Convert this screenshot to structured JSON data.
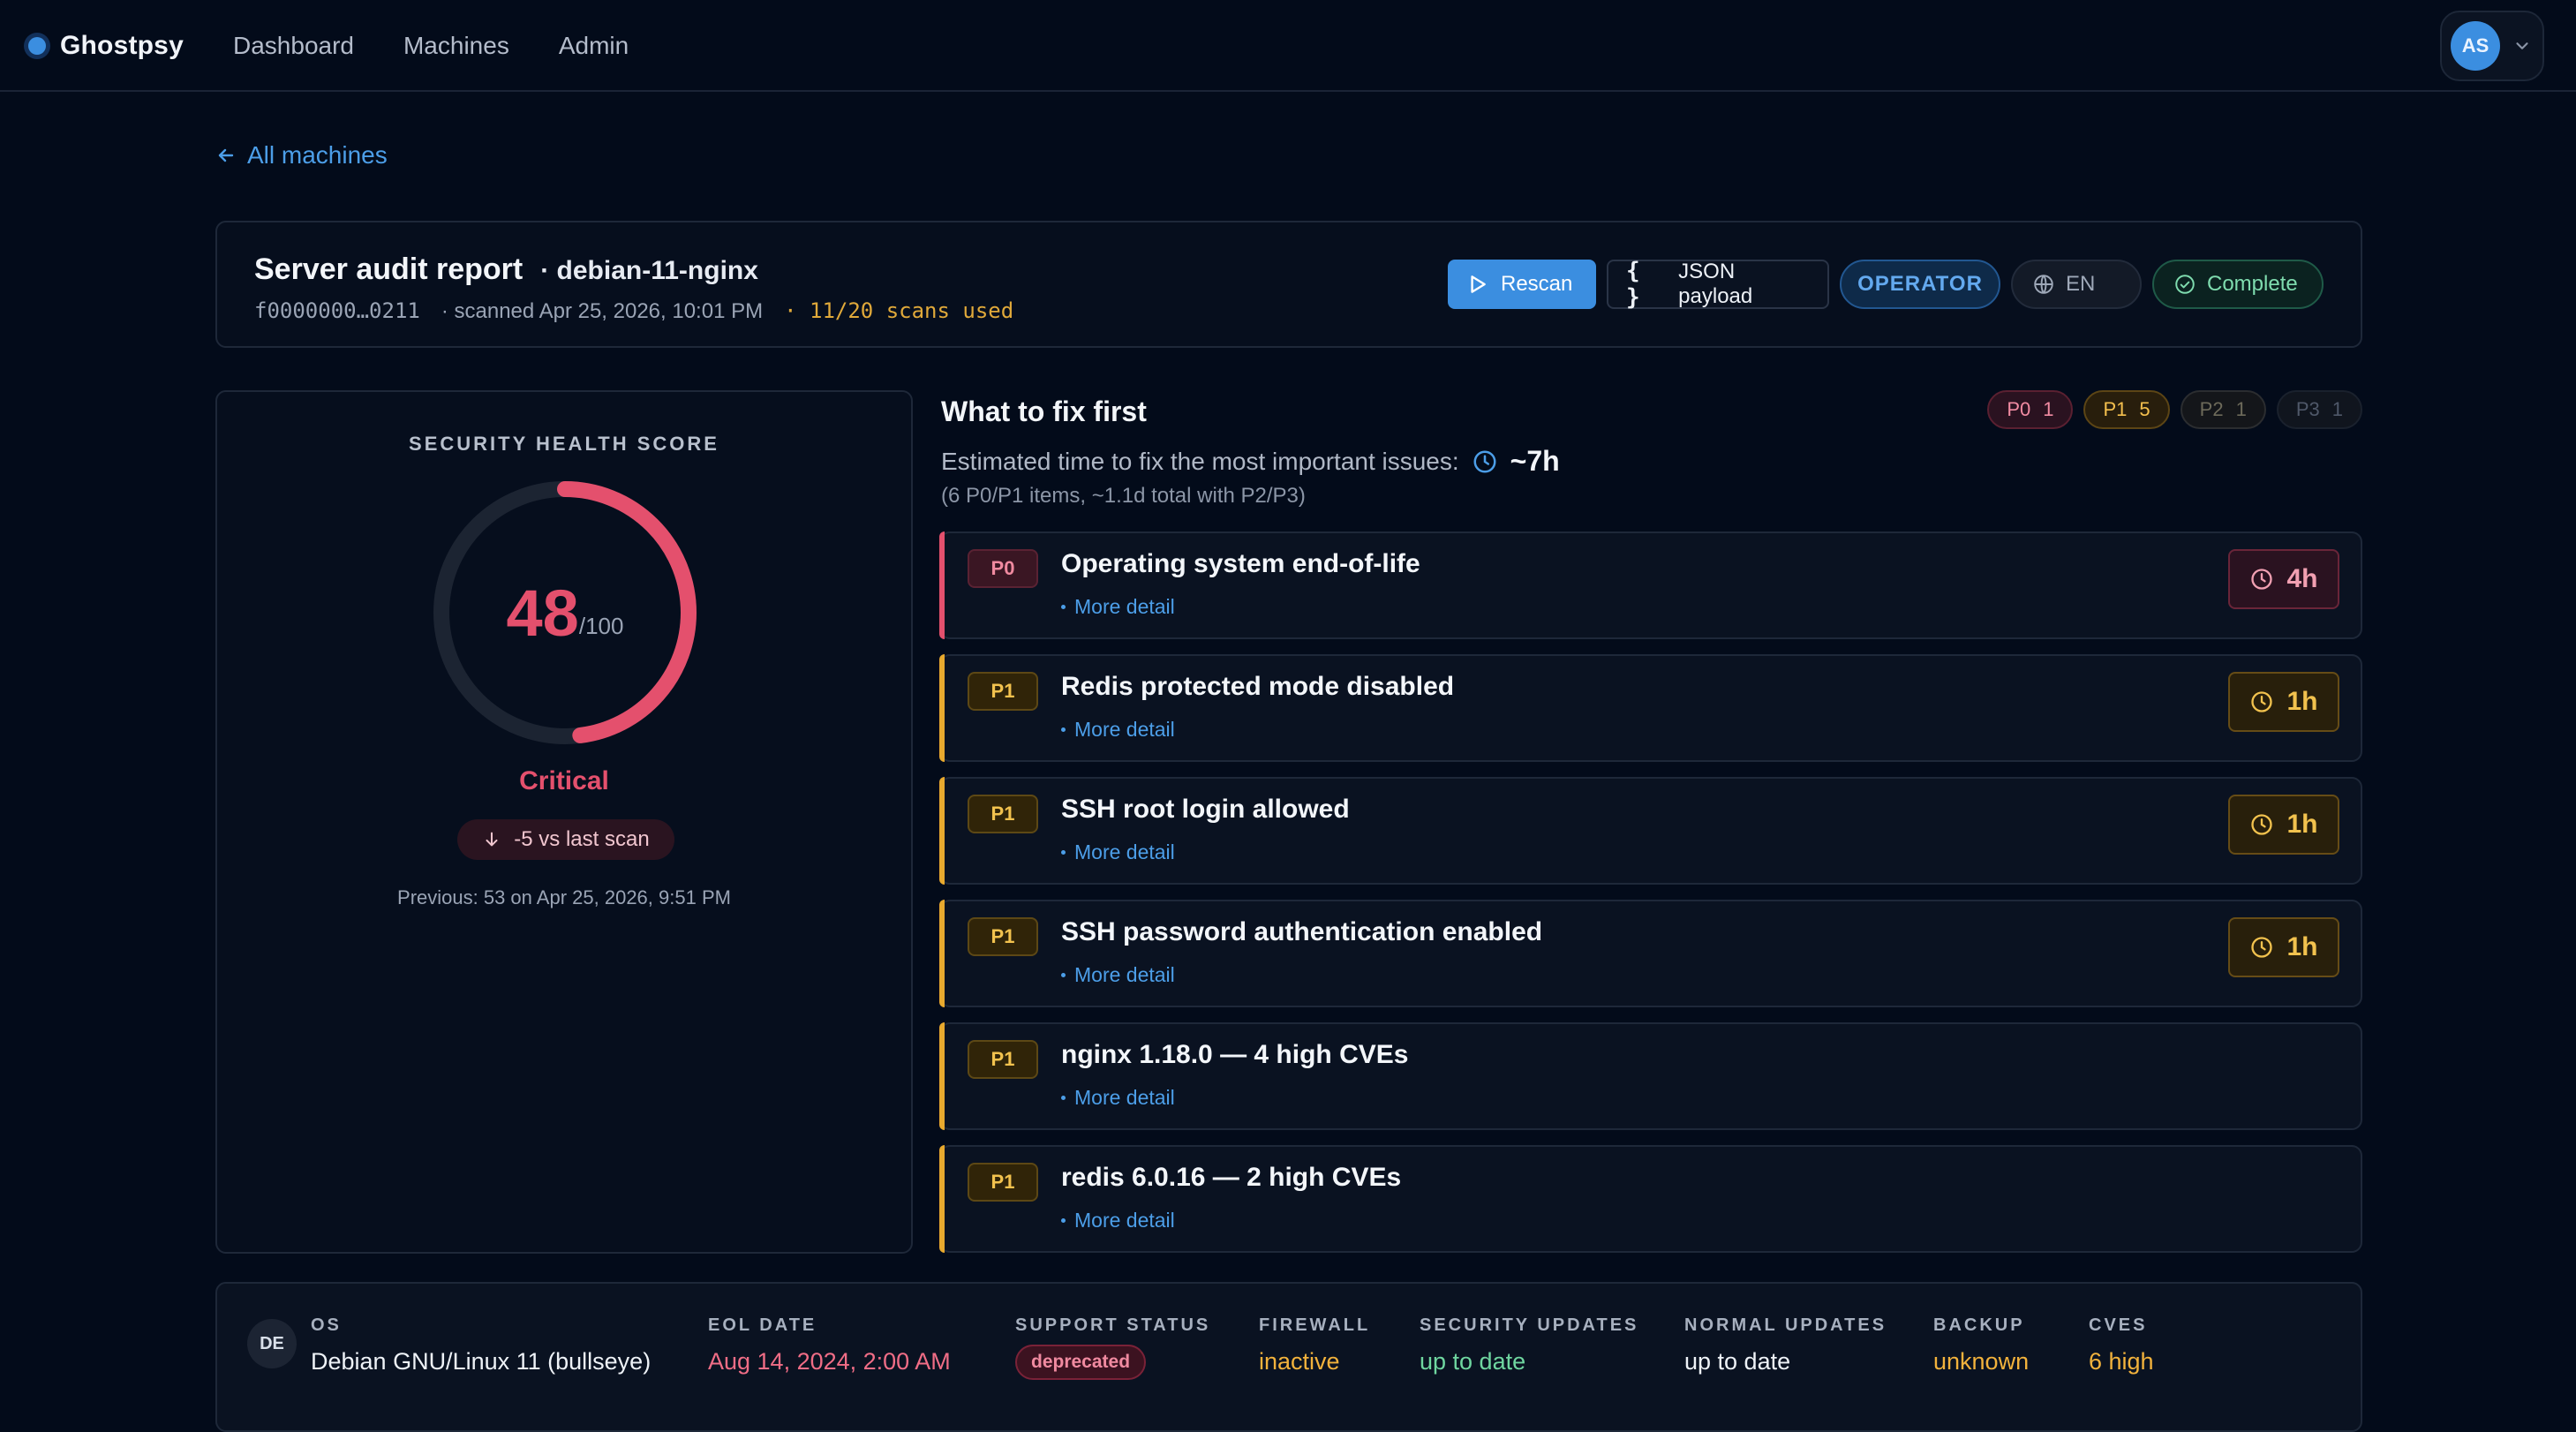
{
  "nav": {
    "brand": "Ghostpsy",
    "links": [
      "Dashboard",
      "Machines",
      "Admin"
    ],
    "user_initials": "AS"
  },
  "back_link": "All machines",
  "header": {
    "title": "Server audit report",
    "machine": "· debian-11-nginx",
    "machine_id": "f0000000…0211",
    "scanned": "· scanned Apr 25, 2026, 10:01 PM",
    "scans_used": "· 11/20 scans used",
    "actions": {
      "rescan": "Rescan",
      "json_payload": "JSON payload",
      "role": "OPERATOR",
      "language": "EN",
      "status": "Complete"
    }
  },
  "score": {
    "label": "SECURITY HEALTH SCORE",
    "value": "48",
    "max": "/100",
    "fraction": 0.48,
    "status": "Critical",
    "delta": "-5 vs last scan",
    "previous": "Previous: 53 on Apr 25, 2026, 9:51 PM",
    "color": "#e4506d"
  },
  "fix_first": {
    "title": "What to fix first",
    "counts": [
      {
        "label": "P0",
        "count": "1"
      },
      {
        "label": "P1",
        "count": "5"
      },
      {
        "label": "P2",
        "count": "1"
      },
      {
        "label": "P3",
        "count": "1"
      }
    ],
    "estimate_label": "Estimated time to fix the most important issues:",
    "estimate_value": "~7h",
    "estimate_sub": "(6 P0/P1 items, ~1.1d total with P2/P3)",
    "more_detail": "More detail",
    "issues": [
      {
        "priority": "P0",
        "title": "Operating system end-of-life",
        "eta": "4h"
      },
      {
        "priority": "P1",
        "title": "Redis protected mode disabled",
        "eta": "1h"
      },
      {
        "priority": "P1",
        "title": "SSH root login allowed",
        "eta": "1h"
      },
      {
        "priority": "P1",
        "title": "SSH password authentication enabled",
        "eta": "1h"
      },
      {
        "priority": "P1",
        "title": "nginx 1.18.0 — 4 high CVEs",
        "eta": ""
      },
      {
        "priority": "P1",
        "title": "redis 6.0.16 — 2 high CVEs",
        "eta": ""
      }
    ]
  },
  "facts": {
    "os_badge": "DE",
    "os_label": "OS",
    "os_value": "Debian GNU/Linux 11 (bullseye)",
    "eol_label": "EOL DATE",
    "eol_value": "Aug 14, 2024, 2:00 AM",
    "support_label": "SUPPORT STATUS",
    "support_value": "deprecated",
    "firewall_label": "FIREWALL",
    "firewall_value": "inactive",
    "sec_updates_label": "SECURITY UPDATES",
    "sec_updates_value": "up to date",
    "normal_updates_label": "NORMAL UPDATES",
    "normal_updates_value": "up to date",
    "backup_label": "BACKUP",
    "backup_value": "unknown",
    "cves_label": "CVES",
    "cves_value": "6 high"
  }
}
